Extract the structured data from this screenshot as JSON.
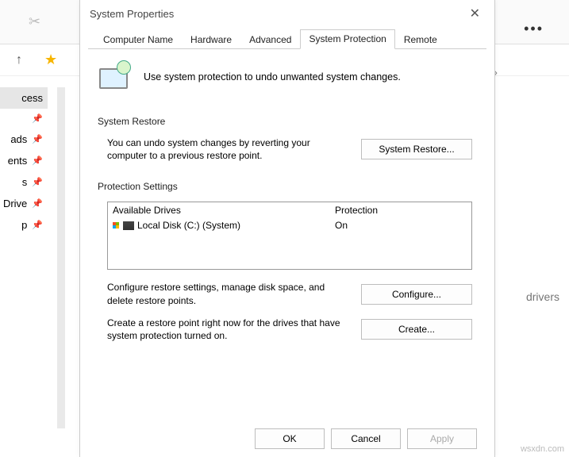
{
  "background": {
    "more_button": "•••",
    "sidebar": {
      "items": [
        {
          "label": "cess",
          "selected": true
        },
        {
          "label": ""
        },
        {
          "label": "ads"
        },
        {
          "label": "ents"
        },
        {
          "label": "s"
        },
        {
          "label": "Drive"
        },
        {
          "label": "p"
        }
      ]
    },
    "right_caret": "›",
    "right_text": "drivers"
  },
  "dialog": {
    "title": "System Properties",
    "tabs": [
      "Computer Name",
      "Hardware",
      "Advanced",
      "System Protection",
      "Remote"
    ],
    "active_tab": "System Protection",
    "intro_text": "Use system protection to undo unwanted system changes.",
    "system_restore": {
      "legend": "System Restore",
      "desc": "You can undo system changes by reverting your computer to a previous restore point.",
      "button": "System Restore..."
    },
    "protection_settings": {
      "legend": "Protection Settings",
      "headers": {
        "drives": "Available Drives",
        "protection": "Protection"
      },
      "rows": [
        {
          "name": "Local Disk (C:) (System)",
          "protection": "On"
        }
      ],
      "configure_desc": "Configure restore settings, manage disk space, and delete restore points.",
      "configure_btn": "Configure...",
      "create_desc": "Create a restore point right now for the drives that have system protection turned on.",
      "create_btn": "Create..."
    },
    "footer": {
      "ok": "OK",
      "cancel": "Cancel",
      "apply": "Apply"
    }
  },
  "watermark": "wsxdn.com"
}
